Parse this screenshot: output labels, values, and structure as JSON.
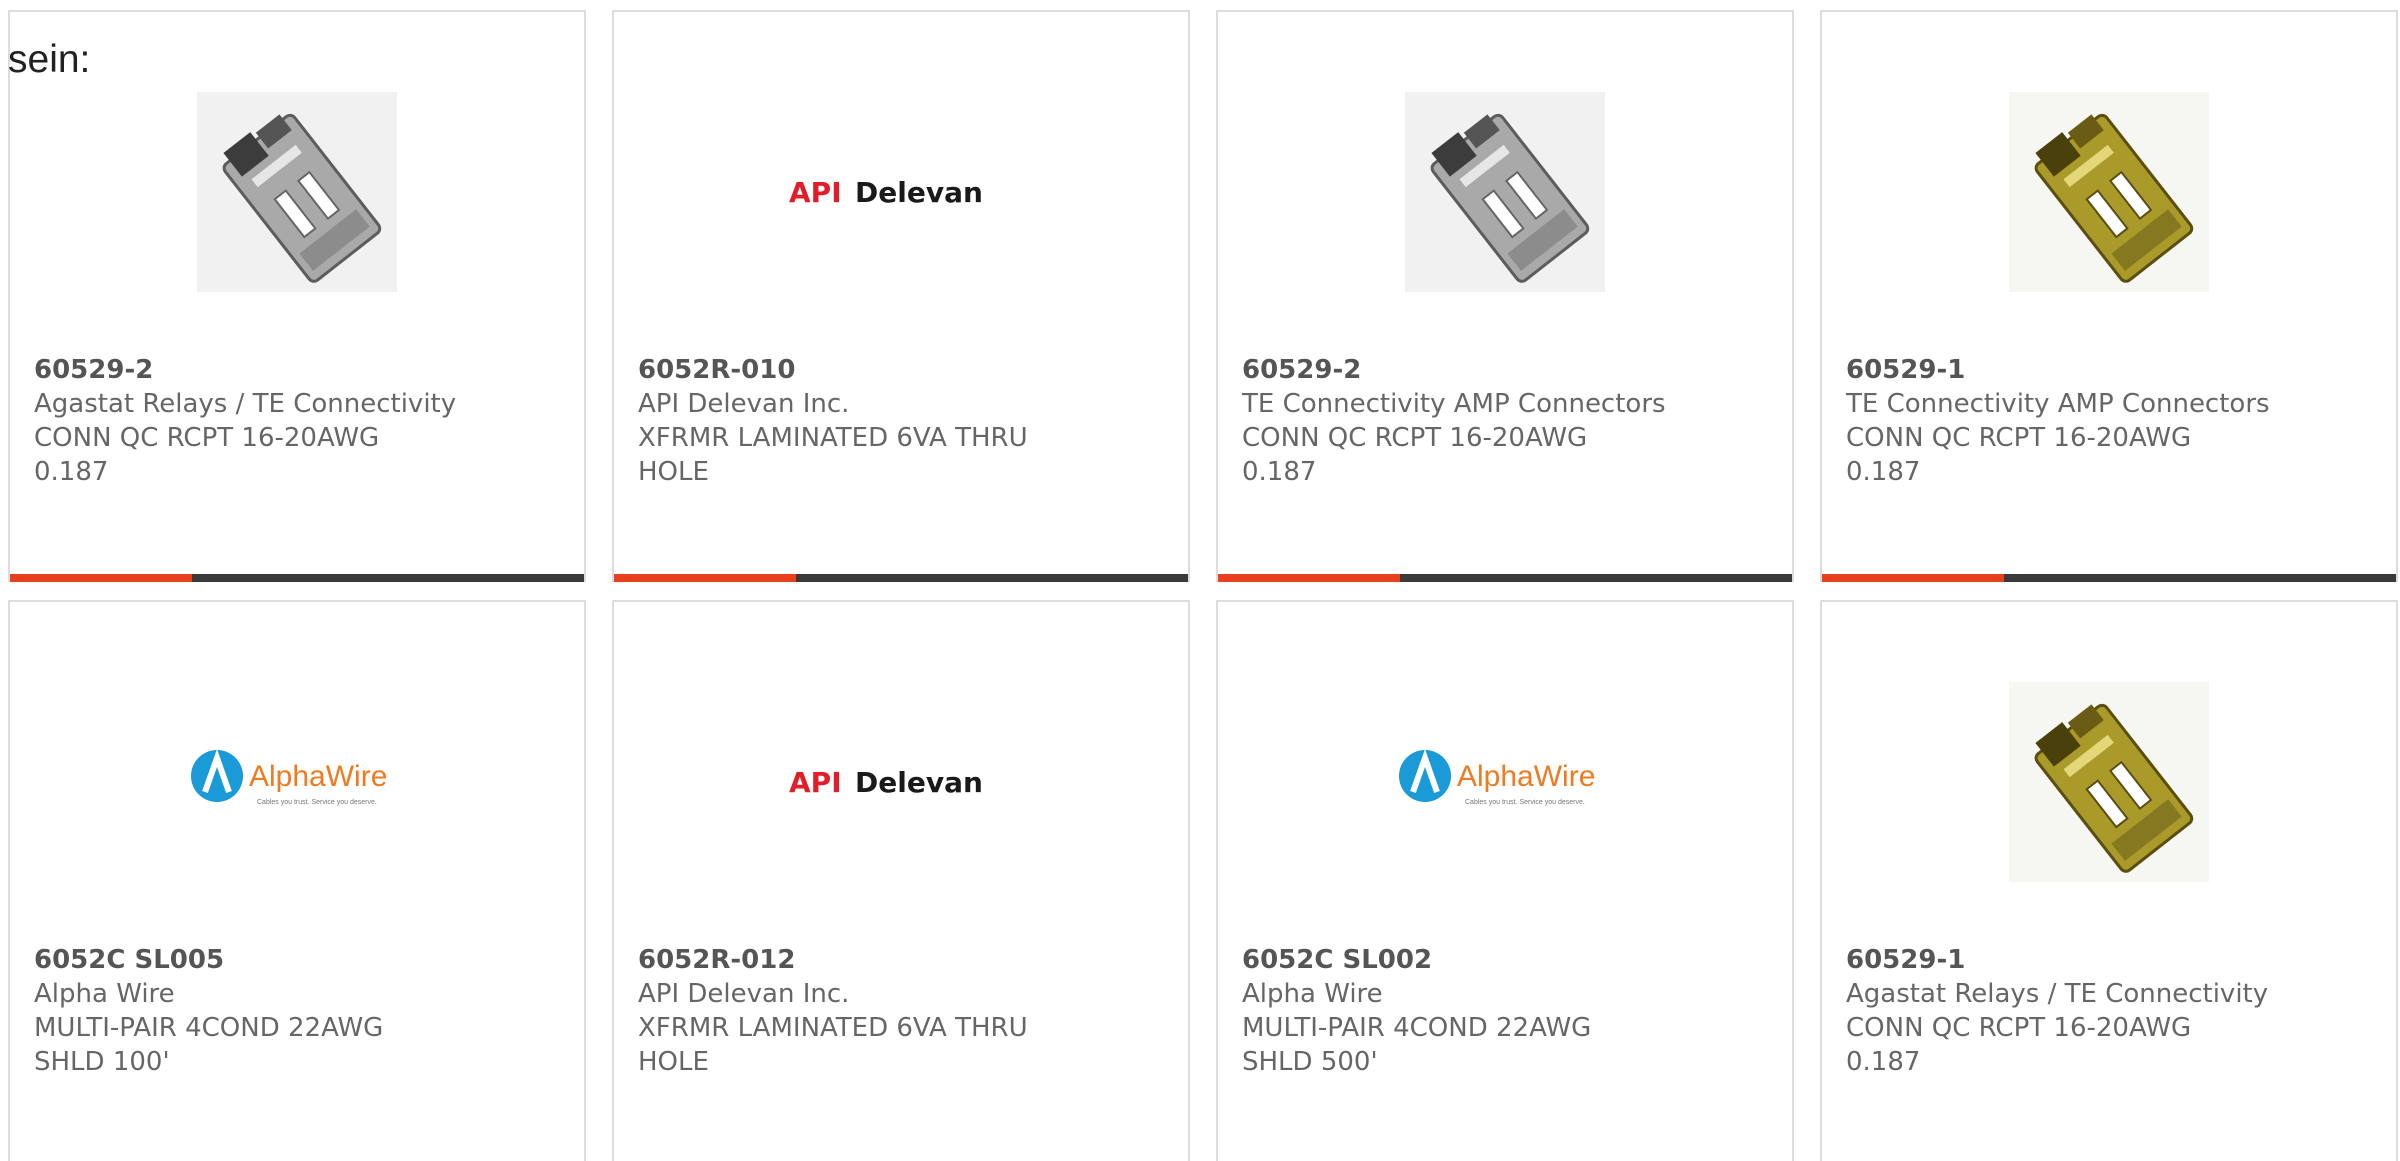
{
  "lead_text": "sein:",
  "colors": {
    "accent": "#e8401c",
    "bar_dark": "#3a3a3a",
    "api_red": "#e11d2a",
    "alpha_blue": "#1a9ad6",
    "alpha_orange": "#f07a20"
  },
  "logos": {
    "api_red": "API",
    "api_dark": "Delevan",
    "alpha_name": "AlphaWire",
    "alpha_tagline": "Cables you trust. Service you deserve."
  },
  "products": [
    {
      "part_number": "60529-2",
      "manufacturer": "Agastat Relays / TE Connectivity",
      "description": "CONN QC RCPT 16-20AWG 0.187",
      "image": "silver-connector-icon"
    },
    {
      "part_number": "6052R-010",
      "manufacturer": "API Delevan Inc.",
      "description": "XFRMR LAMINATED 6VA THRU HOLE",
      "image": "api-delevan-logo"
    },
    {
      "part_number": "60529-2",
      "manufacturer": "TE Connectivity AMP Connectors",
      "description": "CONN QC RCPT 16-20AWG 0.187",
      "image": "silver-connector-icon"
    },
    {
      "part_number": "60529-1",
      "manufacturer": "TE Connectivity AMP Connectors",
      "description": "CONN QC RCPT 16-20AWG 0.187",
      "image": "brass-connector-icon"
    },
    {
      "part_number": "6052C SL005",
      "manufacturer": "Alpha Wire",
      "description": "MULTI-PAIR 4COND 22AWG SHLD 100'",
      "image": "alphawire-logo"
    },
    {
      "part_number": "6052R-012",
      "manufacturer": "API Delevan Inc.",
      "description": "XFRMR LAMINATED 6VA THRU HOLE",
      "image": "api-delevan-logo"
    },
    {
      "part_number": "6052C SL002",
      "manufacturer": "Alpha Wire",
      "description": "MULTI-PAIR 4COND 22AWG SHLD 500'",
      "image": "alphawire-logo"
    },
    {
      "part_number": "60529-1",
      "manufacturer": "Agastat Relays / TE Connectivity",
      "description": "CONN QC RCPT 16-20AWG 0.187",
      "image": "brass-connector-icon"
    }
  ]
}
